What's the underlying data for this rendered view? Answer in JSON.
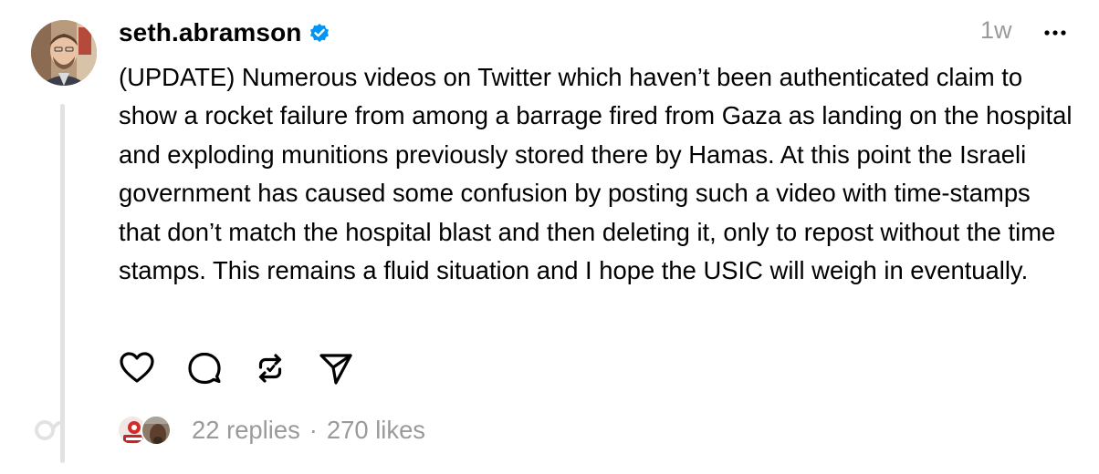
{
  "post": {
    "username": "seth.abramson",
    "timestamp": "1w",
    "text": "(UPDATE) Numerous videos on Twitter which haven’t been authenticated claim to show a rocket failure from among a barrage fired from Gaza as landing on the hospital and exploding munitions previously stored there by Hamas. At this point the Israeli government has caused some confusion by posting such a video with time-stamps that don’t match the hospital blast and then deleting it, only to repost without the time stamps. This remains a fluid situation and I hope the USIC will weigh in eventually.",
    "replies_label": "22 replies",
    "separator": "·",
    "likes_label": "270 likes"
  },
  "icons": {
    "verified": "verified-badge-icon",
    "more": "more-horizontal-icon",
    "like": "heart-icon",
    "reply": "comment-bubble-icon",
    "repost": "repost-icon",
    "share": "send-icon",
    "thread_end": "thread-end-icon"
  },
  "colors": {
    "verified_blue": "#0095f6",
    "muted_text": "#9a9a9a",
    "thread_line": "#e2e2e2"
  }
}
